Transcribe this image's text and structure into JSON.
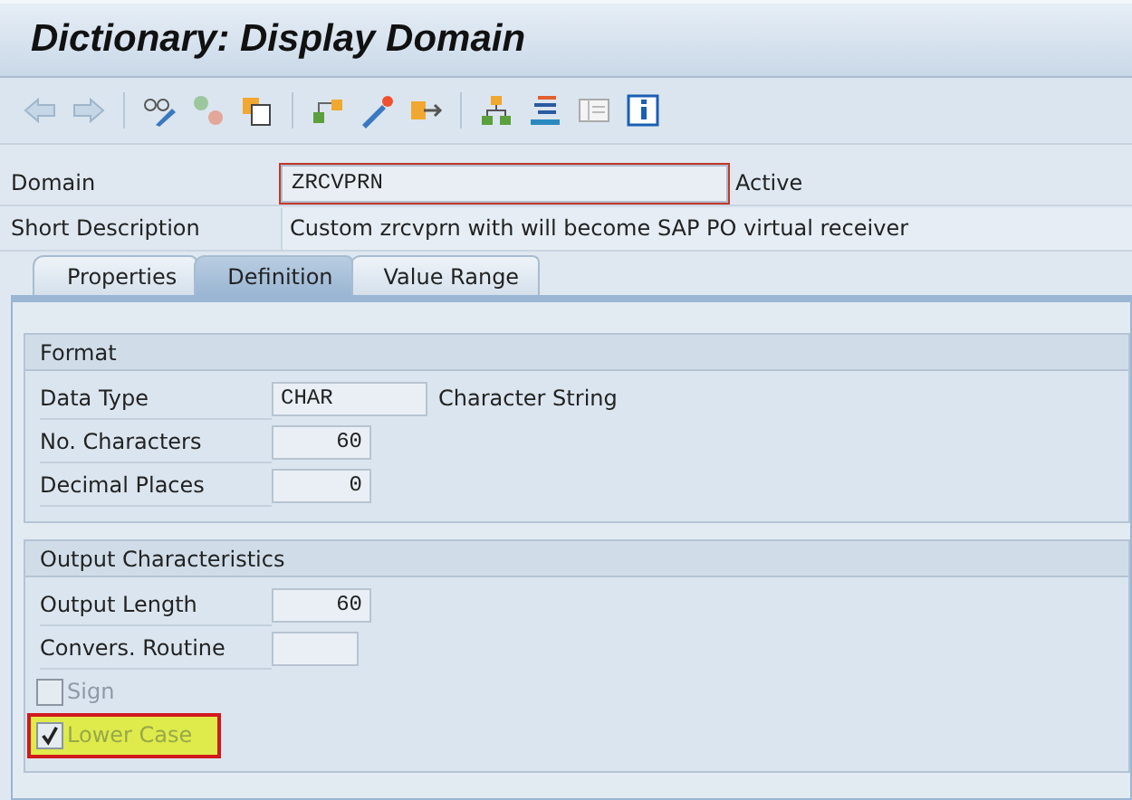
{
  "window": {
    "title": "Dictionary: Display Domain"
  },
  "header_fields": [
    {
      "label": "Domain",
      "value": "ZRCVPRN",
      "status": "Active",
      "kind": "input"
    },
    {
      "label": "Short Description",
      "value": "Custom zrcvprn with will become SAP PO virtual receiver",
      "kind": "text"
    }
  ],
  "tabs": [
    {
      "label": "Properties",
      "selected": false
    },
    {
      "label": "Definition",
      "selected": true
    },
    {
      "label": "Value Range",
      "selected": false
    }
  ],
  "groups": [
    {
      "title": "Format",
      "rows": [
        {
          "kind": "text_field",
          "label": "Data Type",
          "value": "CHAR",
          "note": "Character String"
        },
        {
          "kind": "number_field",
          "label": "No. Characters",
          "value": "60"
        },
        {
          "kind": "number_field",
          "label": "Decimal Places",
          "value": "0"
        }
      ]
    },
    {
      "title": "Output Characteristics",
      "rows": [
        {
          "kind": "number_field",
          "label": "Output Length",
          "value": "60"
        },
        {
          "kind": "text_field",
          "label": "Convers. Routine"
        },
        {
          "kind": "checkbox",
          "label": "Sign",
          "checked": false,
          "highlighted": false
        },
        {
          "kind": "checkbox",
          "label": "Lower Case",
          "checked": true,
          "highlighted": true
        }
      ]
    }
  ]
}
